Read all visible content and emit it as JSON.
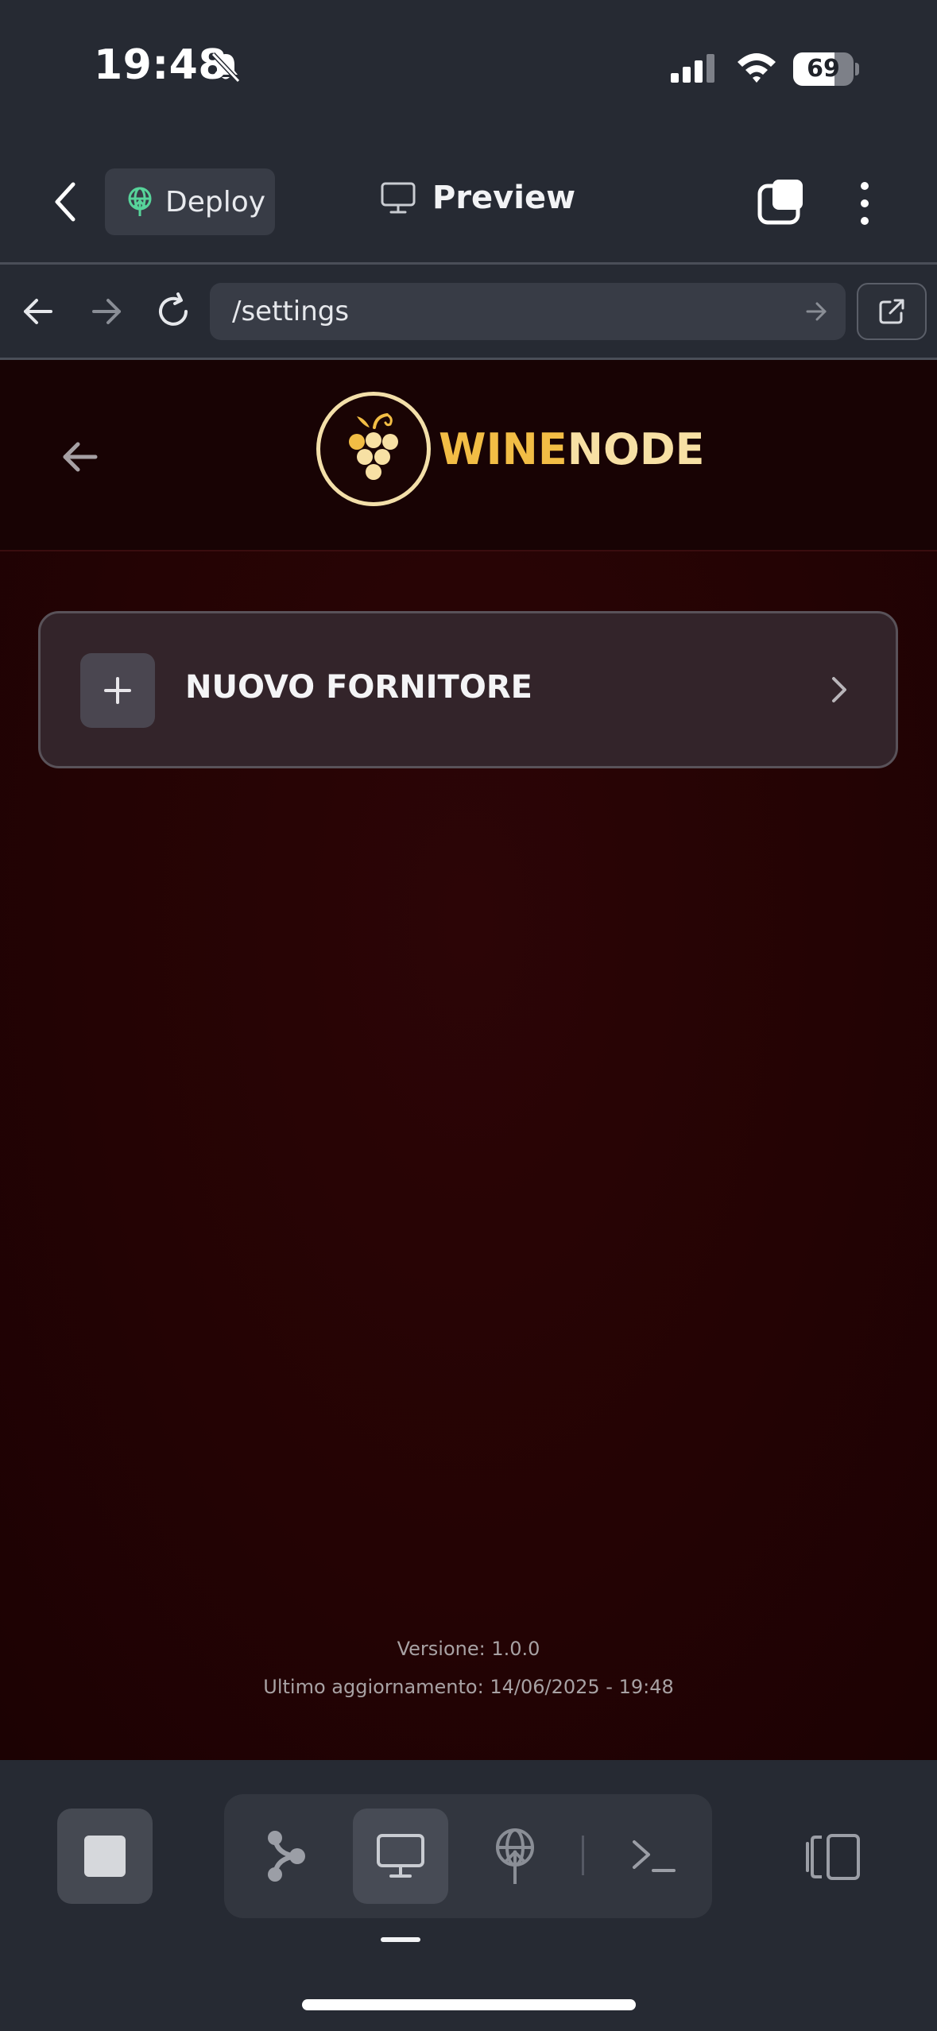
{
  "status_bar": {
    "time": "19:48",
    "battery_percent": "69",
    "battery_level": 0.69
  },
  "top_nav": {
    "deploy_label": "Deploy",
    "preview_label": "Preview"
  },
  "browser": {
    "url": "/settings"
  },
  "app": {
    "brand_part1": "WINE",
    "brand_part2": "NODE",
    "card_label": "NUOVO FORNITORE",
    "version_text": "Versione: 1.0.0",
    "updated_text": "Ultimo aggiornamento: 14/06/2025 - 19:48"
  },
  "icons": {
    "status": [
      "bell-slash-icon",
      "signal-icon",
      "wifi-icon",
      "battery-icon"
    ],
    "nav": [
      "chevron-left-icon",
      "deploy-globe-icon",
      "monitor-icon",
      "tabs-icon",
      "more-vertical-icon"
    ],
    "browser": [
      "arrow-left-icon",
      "arrow-right-icon",
      "reload-icon",
      "arrow-right-icon",
      "external-link-icon"
    ],
    "toolbar": [
      "stop-icon",
      "git-branch-icon",
      "monitor-icon",
      "deploy-globe-icon",
      "terminal-icon",
      "panel-icon"
    ]
  },
  "colors": {
    "chrome_bg": "#262a33",
    "app_bg": "#240304",
    "brand_gold": "#f2bd45",
    "brand_cream": "#f7e0a4"
  }
}
